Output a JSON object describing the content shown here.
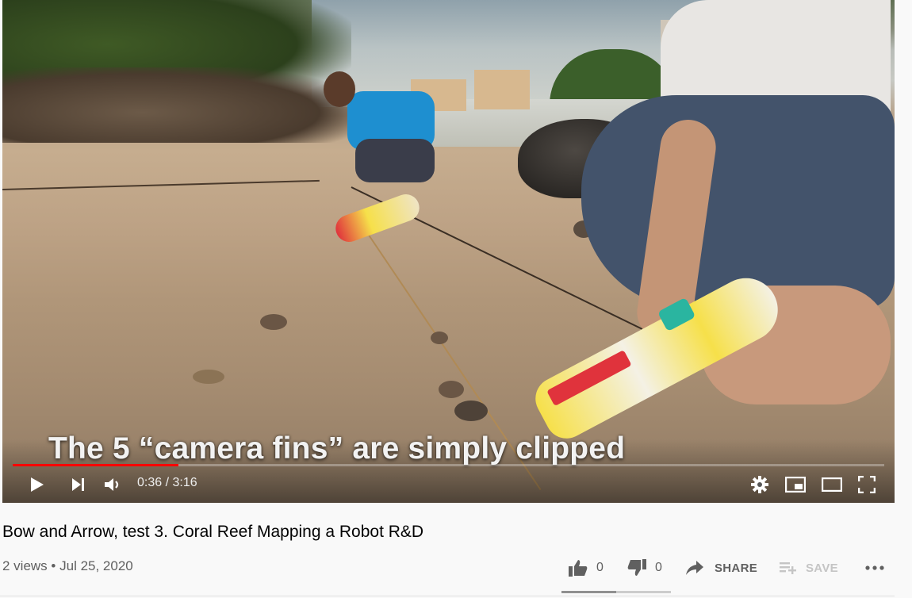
{
  "video": {
    "caption": "The 5 “camera fins” are simply clipped",
    "progress_fraction": 0.19,
    "current_time": "0:36",
    "time_separator": "/",
    "duration": "3:16"
  },
  "controls": {
    "play_icon": "play-icon",
    "next_icon": "next-icon",
    "volume_icon": "volume-icon",
    "settings_icon": "gear-icon",
    "miniplayer_icon": "miniplayer-icon",
    "theater_icon": "theater-icon",
    "fullscreen_icon": "fullscreen-icon"
  },
  "info": {
    "title": "Bow and Arrow, test 3. Coral Reef Mapping a Robot R&D",
    "views": "2 views",
    "dot": "•",
    "date": "Jul 25, 2020"
  },
  "actions": {
    "likes": "0",
    "dislikes": "0",
    "share_label": "SHARE",
    "save_label": "SAVE",
    "like_fraction": 0.5
  },
  "colors": {
    "progress": "#ff0000",
    "text_secondary": "#606060",
    "save_disabled": "#c5c5c5"
  }
}
